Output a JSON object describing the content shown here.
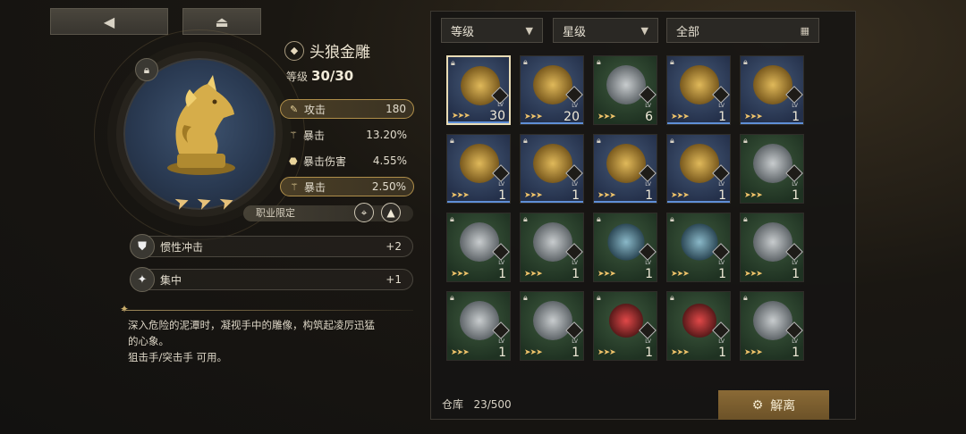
{
  "nav": {
    "back_icon": "◀",
    "home_icon": "⏏"
  },
  "item": {
    "name": "头狼金雕",
    "level_label": "等级",
    "level": "30/30",
    "stats": [
      {
        "icon": "✎",
        "name": "攻击",
        "value": "180",
        "highlight": true
      },
      {
        "icon": "⚚",
        "name": "暴击",
        "value": "13.20%",
        "highlight": false
      },
      {
        "icon": "⬣",
        "name": "暴击伤害",
        "value": "4.55%",
        "highlight": false
      },
      {
        "icon": "⚚",
        "name": "暴击",
        "value": "2.50%",
        "highlight": true
      }
    ],
    "class_limit": "职业限定",
    "skills": [
      {
        "name": "惯性冲击",
        "value": "+2"
      },
      {
        "name": "集中",
        "value": "+1"
      }
    ],
    "description_lines": [
      "深入危险的泥潭时，凝视手中的雕像，构筑起凌厉迅猛",
      "的心象。",
      "狙击手/突击手 可用。"
    ]
  },
  "filters": {
    "level": "等级",
    "stars": "星级",
    "all": "全部"
  },
  "storage": {
    "label": "仓库",
    "count": "23/500"
  },
  "dismantle_label": "解离",
  "cells": [
    {
      "bg": "gold",
      "art": "gold",
      "lv": "30",
      "selected": true
    },
    {
      "bg": "gold",
      "art": "gold",
      "lv": "20"
    },
    {
      "bg": "green",
      "art": "silver",
      "lv": "6"
    },
    {
      "bg": "gold",
      "art": "gold",
      "lv": "1"
    },
    {
      "bg": "gold",
      "art": "gold",
      "lv": "1"
    },
    {
      "bg": "gold",
      "art": "gold",
      "lv": "1"
    },
    {
      "bg": "gold",
      "art": "gold",
      "lv": "1"
    },
    {
      "bg": "gold",
      "art": "gold",
      "lv": "1"
    },
    {
      "bg": "gold",
      "art": "gold",
      "lv": "1"
    },
    {
      "bg": "green",
      "art": "silver",
      "lv": "1"
    },
    {
      "bg": "green",
      "art": "silver",
      "lv": "1"
    },
    {
      "bg": "green",
      "art": "silver",
      "lv": "1"
    },
    {
      "bg": "green",
      "art": "teal",
      "lv": "1"
    },
    {
      "bg": "green",
      "art": "teal",
      "lv": "1"
    },
    {
      "bg": "green",
      "art": "silver",
      "lv": "1"
    },
    {
      "bg": "green",
      "art": "silver",
      "lv": "1"
    },
    {
      "bg": "green",
      "art": "silver",
      "lv": "1"
    },
    {
      "bg": "green",
      "art": "red",
      "lv": "1"
    },
    {
      "bg": "green",
      "art": "red",
      "lv": "1"
    },
    {
      "bg": "green",
      "art": "silver",
      "lv": "1"
    }
  ],
  "colors": {
    "accent": "#b08f4a",
    "selected_border": "#e9dcb6",
    "star": "#efc36a"
  }
}
